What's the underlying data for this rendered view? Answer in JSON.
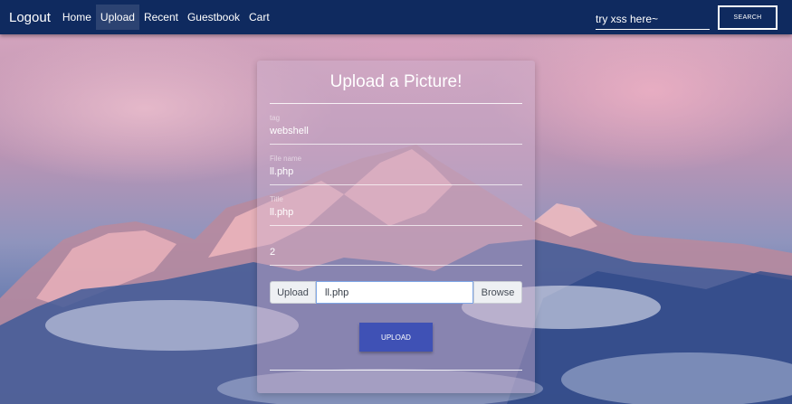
{
  "navbar": {
    "brand": "Logout",
    "links": [
      "Home",
      "Upload",
      "Recent",
      "Guestbook",
      "Cart"
    ],
    "active_link": "Upload",
    "search_value": "try xss here~",
    "search_button": "SEARCH"
  },
  "form": {
    "title": "Upload a Picture!",
    "fields": [
      {
        "label": "tag",
        "value": "webshell"
      },
      {
        "label": "File name",
        "value": "ll.php"
      },
      {
        "label": "Title",
        "value": "ll.php"
      },
      {
        "label": "",
        "value": "2"
      }
    ],
    "upload_prefix": "Upload",
    "file_value": "ll.php",
    "browse_label": "Browse",
    "submit_label": "UPLOAD"
  },
  "colors": {
    "navbar": "#0f2a5f",
    "submit": "#3f51b5"
  }
}
